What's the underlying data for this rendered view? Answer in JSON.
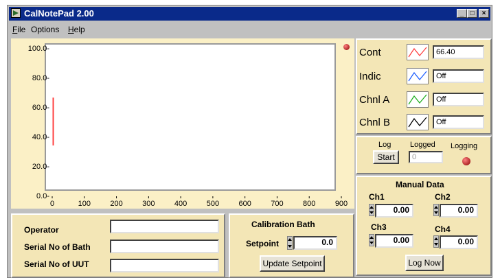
{
  "window": {
    "title": "CalNotePad 2.00",
    "controls": [
      "_",
      "□",
      "×"
    ]
  },
  "menu": {
    "items": [
      {
        "label": "File"
      },
      {
        "label": "Options"
      },
      {
        "label": "Help"
      }
    ]
  },
  "chart_data": {
    "type": "line",
    "x_ticks": [
      "0",
      "100",
      "200",
      "300",
      "400",
      "500",
      "600",
      "700",
      "800",
      "900"
    ],
    "y_ticks": [
      "100.0-",
      "80.0-",
      "60.0-",
      "40.0-",
      "20.0-",
      "0.0-"
    ],
    "xlim": [
      0,
      900
    ],
    "ylim": [
      0,
      100
    ],
    "series": [
      {
        "name": "Cont",
        "color": "#ff4040",
        "x": [
          0,
          0
        ],
        "y": [
          34,
          66.4
        ]
      }
    ]
  },
  "channels": [
    {
      "label": "Cont",
      "value": "66.40",
      "color": "#ff4040"
    },
    {
      "label": "Indic",
      "value": "Off",
      "color": "#2060ff"
    },
    {
      "label": "Chnl A",
      "value": "Off",
      "color": "#20b020"
    },
    {
      "label": "Chnl B",
      "value": "Off",
      "color": "#000000"
    }
  ],
  "logging": {
    "log_label": "Log",
    "start_label": "Start",
    "logged_label": "Logged",
    "logged_value": "0",
    "logging_label": "Logging"
  },
  "manual_data": {
    "title": "Manual Data",
    "ch1_label": "Ch1",
    "ch1_value": "0.00",
    "ch2_label": "Ch2",
    "ch2_value": "0.00",
    "ch3_label": "Ch3",
    "ch3_value": "0.00",
    "ch4_label": "Ch4",
    "ch4_value": "0.00",
    "log_now_label": "Log Now"
  },
  "info": {
    "operator_label": "Operator",
    "serial_bath_label": "Serial No of Bath",
    "serial_uut_label": "Serial No of UUT",
    "operator_value": "",
    "serial_bath_value": "",
    "serial_uut_value": ""
  },
  "calibration": {
    "title": "Calibration Bath",
    "setpoint_label": "Setpoint",
    "setpoint_value": "0.0",
    "update_label": "Update Setpoint"
  }
}
